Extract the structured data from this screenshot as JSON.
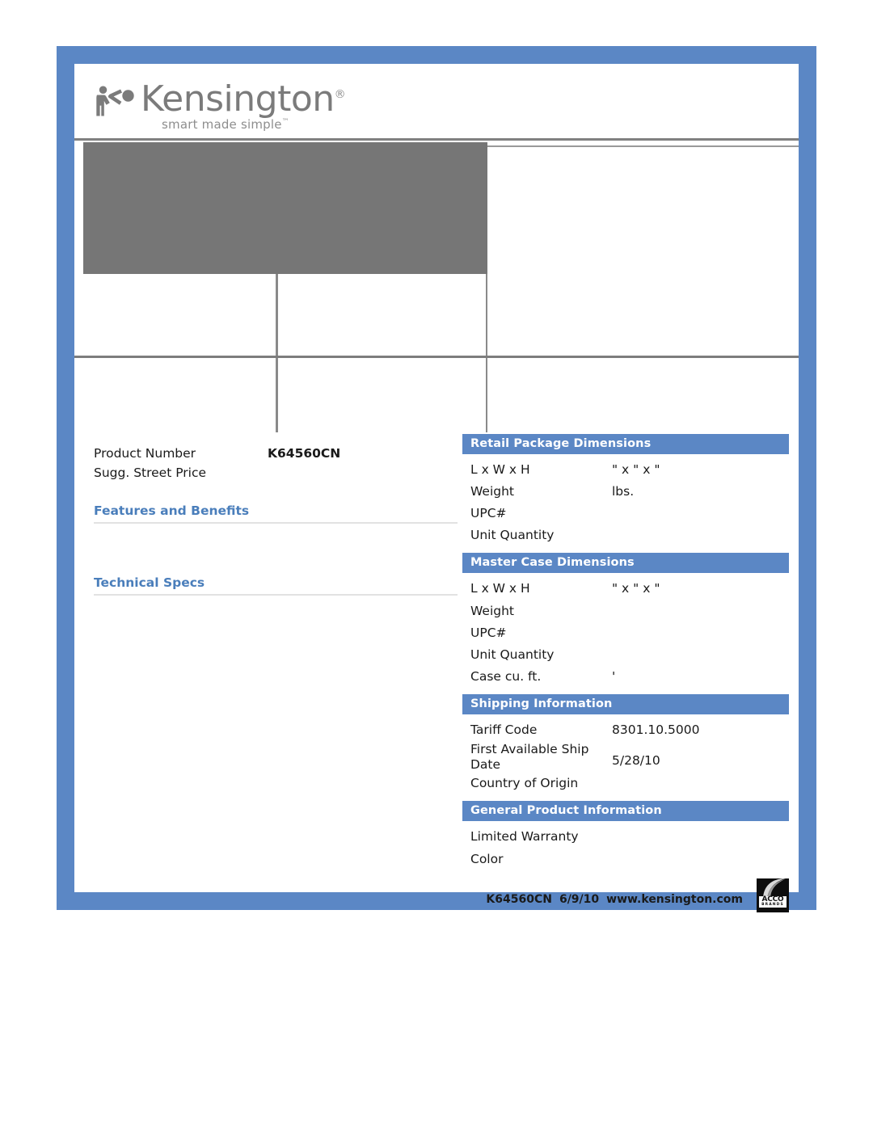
{
  "brand": {
    "name": "Kensington",
    "registered_mark": "®",
    "tagline": "smart made simple",
    "tagline_mark": "™",
    "logo_icon": "kensington-figure-icon"
  },
  "product": {
    "rows": [
      {
        "key": "Product Number",
        "value": "K64560CN"
      },
      {
        "key": "Sugg. Street Price",
        "value": ""
      }
    ]
  },
  "sections": {
    "features_and_benefits": "Features and Benefits",
    "technical_specs": "Technical Specs"
  },
  "panels": [
    {
      "title": "Retail Package Dimensions",
      "rows": [
        {
          "key": "L x W x H",
          "value": "\" x \" x \""
        },
        {
          "key": "Weight",
          "value": "lbs."
        },
        {
          "key": "UPC#",
          "value": ""
        },
        {
          "key": "Unit Quantity",
          "value": ""
        }
      ]
    },
    {
      "title": "Master Case Dimensions",
      "rows": [
        {
          "key": "L x W x H",
          "value": "\" x \" x \""
        },
        {
          "key": "Weight",
          "value": ""
        },
        {
          "key": "UPC#",
          "value": ""
        },
        {
          "key": "Unit Quantity",
          "value": ""
        },
        {
          "key": "Case cu. ft.",
          "value": "'"
        }
      ]
    },
    {
      "title": "Shipping Information",
      "rows": [
        {
          "key": "Tariff Code",
          "value": "8301.10.5000"
        },
        {
          "key": "First Available Ship Date",
          "value": "5/28/10"
        },
        {
          "key": "Country of Origin",
          "value": ""
        }
      ]
    },
    {
      "title": "General Product Information",
      "rows": [
        {
          "key": "Limited Warranty",
          "value": ""
        },
        {
          "key": "Color",
          "value": ""
        }
      ]
    }
  ],
  "footer": {
    "product_number": "K64560CN",
    "date": "6/9/10",
    "website": "www.kensington.com",
    "logo_name": "ACCO",
    "logo_sub": "BRANDS",
    "logo_icon": "acco-brands-logo"
  },
  "colors": {
    "frame_blue": "#5b87c5",
    "panel_header_blue": "#5b87c5",
    "section_head_blue": "#4a7ebb",
    "logo_gray": "#7b7b7b",
    "hero_placeholder_gray": "#767676"
  }
}
